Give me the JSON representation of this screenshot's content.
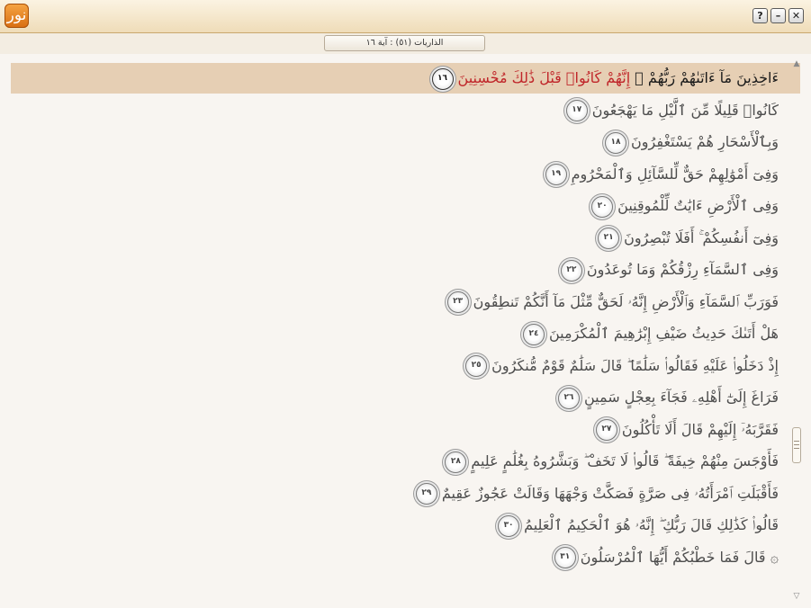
{
  "window": {
    "logo_glyph": "نور",
    "help_label": "?",
    "minimize_label": "–",
    "close_label": "✕"
  },
  "breadcrumb": {
    "text": "الذاريات (٥١) : آية ١٦"
  },
  "verses": [
    {
      "lead": "ءَاخِذِينَ مَآ ءَاتَىٰهُمْ رَبُّهُمْ ۚ ",
      "kw": "إِنَّهُمْ كَانُوا۟ قَبْلَ ذَٰلِكَ مُحْسِنِينَ",
      "num": "١٦",
      "active": true
    },
    {
      "text": "كَانُوا۟ قَلِيلًا مِّنَ ٱلَّيْلِ مَا يَهْجَعُونَ",
      "num": "١٧"
    },
    {
      "text": "وَبِٱلْأَسْحَارِ هُمْ يَسْتَغْفِرُونَ",
      "num": "١٨"
    },
    {
      "text": "وَفِىٓ أَمْوَٰلِهِمْ حَقٌّ لِّلسَّآئِلِ وَٱلْمَحْرُومِ",
      "num": "١٩"
    },
    {
      "text": "وَفِى ٱلْأَرْضِ ءَايَٰتٌ لِّلْمُوقِنِينَ",
      "num": "٢٠"
    },
    {
      "text": "وَفِىٓ أَنفُسِكُمْ ۚ أَفَلَا تُبْصِرُونَ",
      "num": "٢١"
    },
    {
      "text": "وَفِى ٱلسَّمَآءِ رِزْقُكُمْ وَمَا تُوعَدُونَ",
      "num": "٢٢"
    },
    {
      "text": "فَوَرَبِّ ٱلسَّمَآءِ وَٱلْأَرْضِ إِنَّهُۥ لَحَقٌّ مِّثْلَ مَآ أَنَّكُمْ تَنطِقُونَ",
      "num": "٢٣"
    },
    {
      "text": "هَلْ أَتَىٰكَ حَدِيثُ ضَيْفِ إِبْرَٰهِيمَ ٱلْمُكْرَمِينَ",
      "num": "٢٤"
    },
    {
      "text": "إِذْ دَخَلُوا۟ عَلَيْهِ فَقَالُوا۟ سَلَٰمًا ۖ قَالَ سَلَٰمٌ قَوْمٌ مُّنكَرُونَ",
      "num": "٢٥"
    },
    {
      "text": "فَرَاغَ إِلَىٰٓ أَهْلِهِۦ فَجَآءَ بِعِجْلٍ سَمِينٍ",
      "num": "٢٦"
    },
    {
      "text": "فَقَرَّبَهُۥٓ إِلَيْهِمْ قَالَ أَلَا تَأْكُلُونَ",
      "num": "٢٧"
    },
    {
      "text": "فَأَوْجَسَ مِنْهُمْ خِيفَةً ۖ قَالُوا۟ لَا تَخَفْ ۖ وَبَشَّرُوهُ بِغُلَٰمٍ عَلِيمٍ",
      "num": "٢٨"
    },
    {
      "text": "فَأَقْبَلَتِ ٱمْرَأَتُهُۥ فِى صَرَّةٍ فَصَكَّتْ وَجْهَهَا وَقَالَتْ عَجُوزٌ عَقِيمٌ",
      "num": "٢٩"
    },
    {
      "text": "قَالُوا۟ كَذَٰلِكِ قَالَ رَبُّكِ ۖ إِنَّهُۥ هُوَ ٱلْحَكِيمُ ٱلْعَلِيمُ",
      "num": "٣٠"
    },
    {
      "text": "۞ قَالَ فَمَا خَطْبُكُمْ أَيُّهَا ٱلْمُرْسَلُونَ",
      "num": "٣١"
    }
  ],
  "scroll": {
    "up_glyph": "▲",
    "down_glyph": "▽",
    "position": 0.68
  }
}
